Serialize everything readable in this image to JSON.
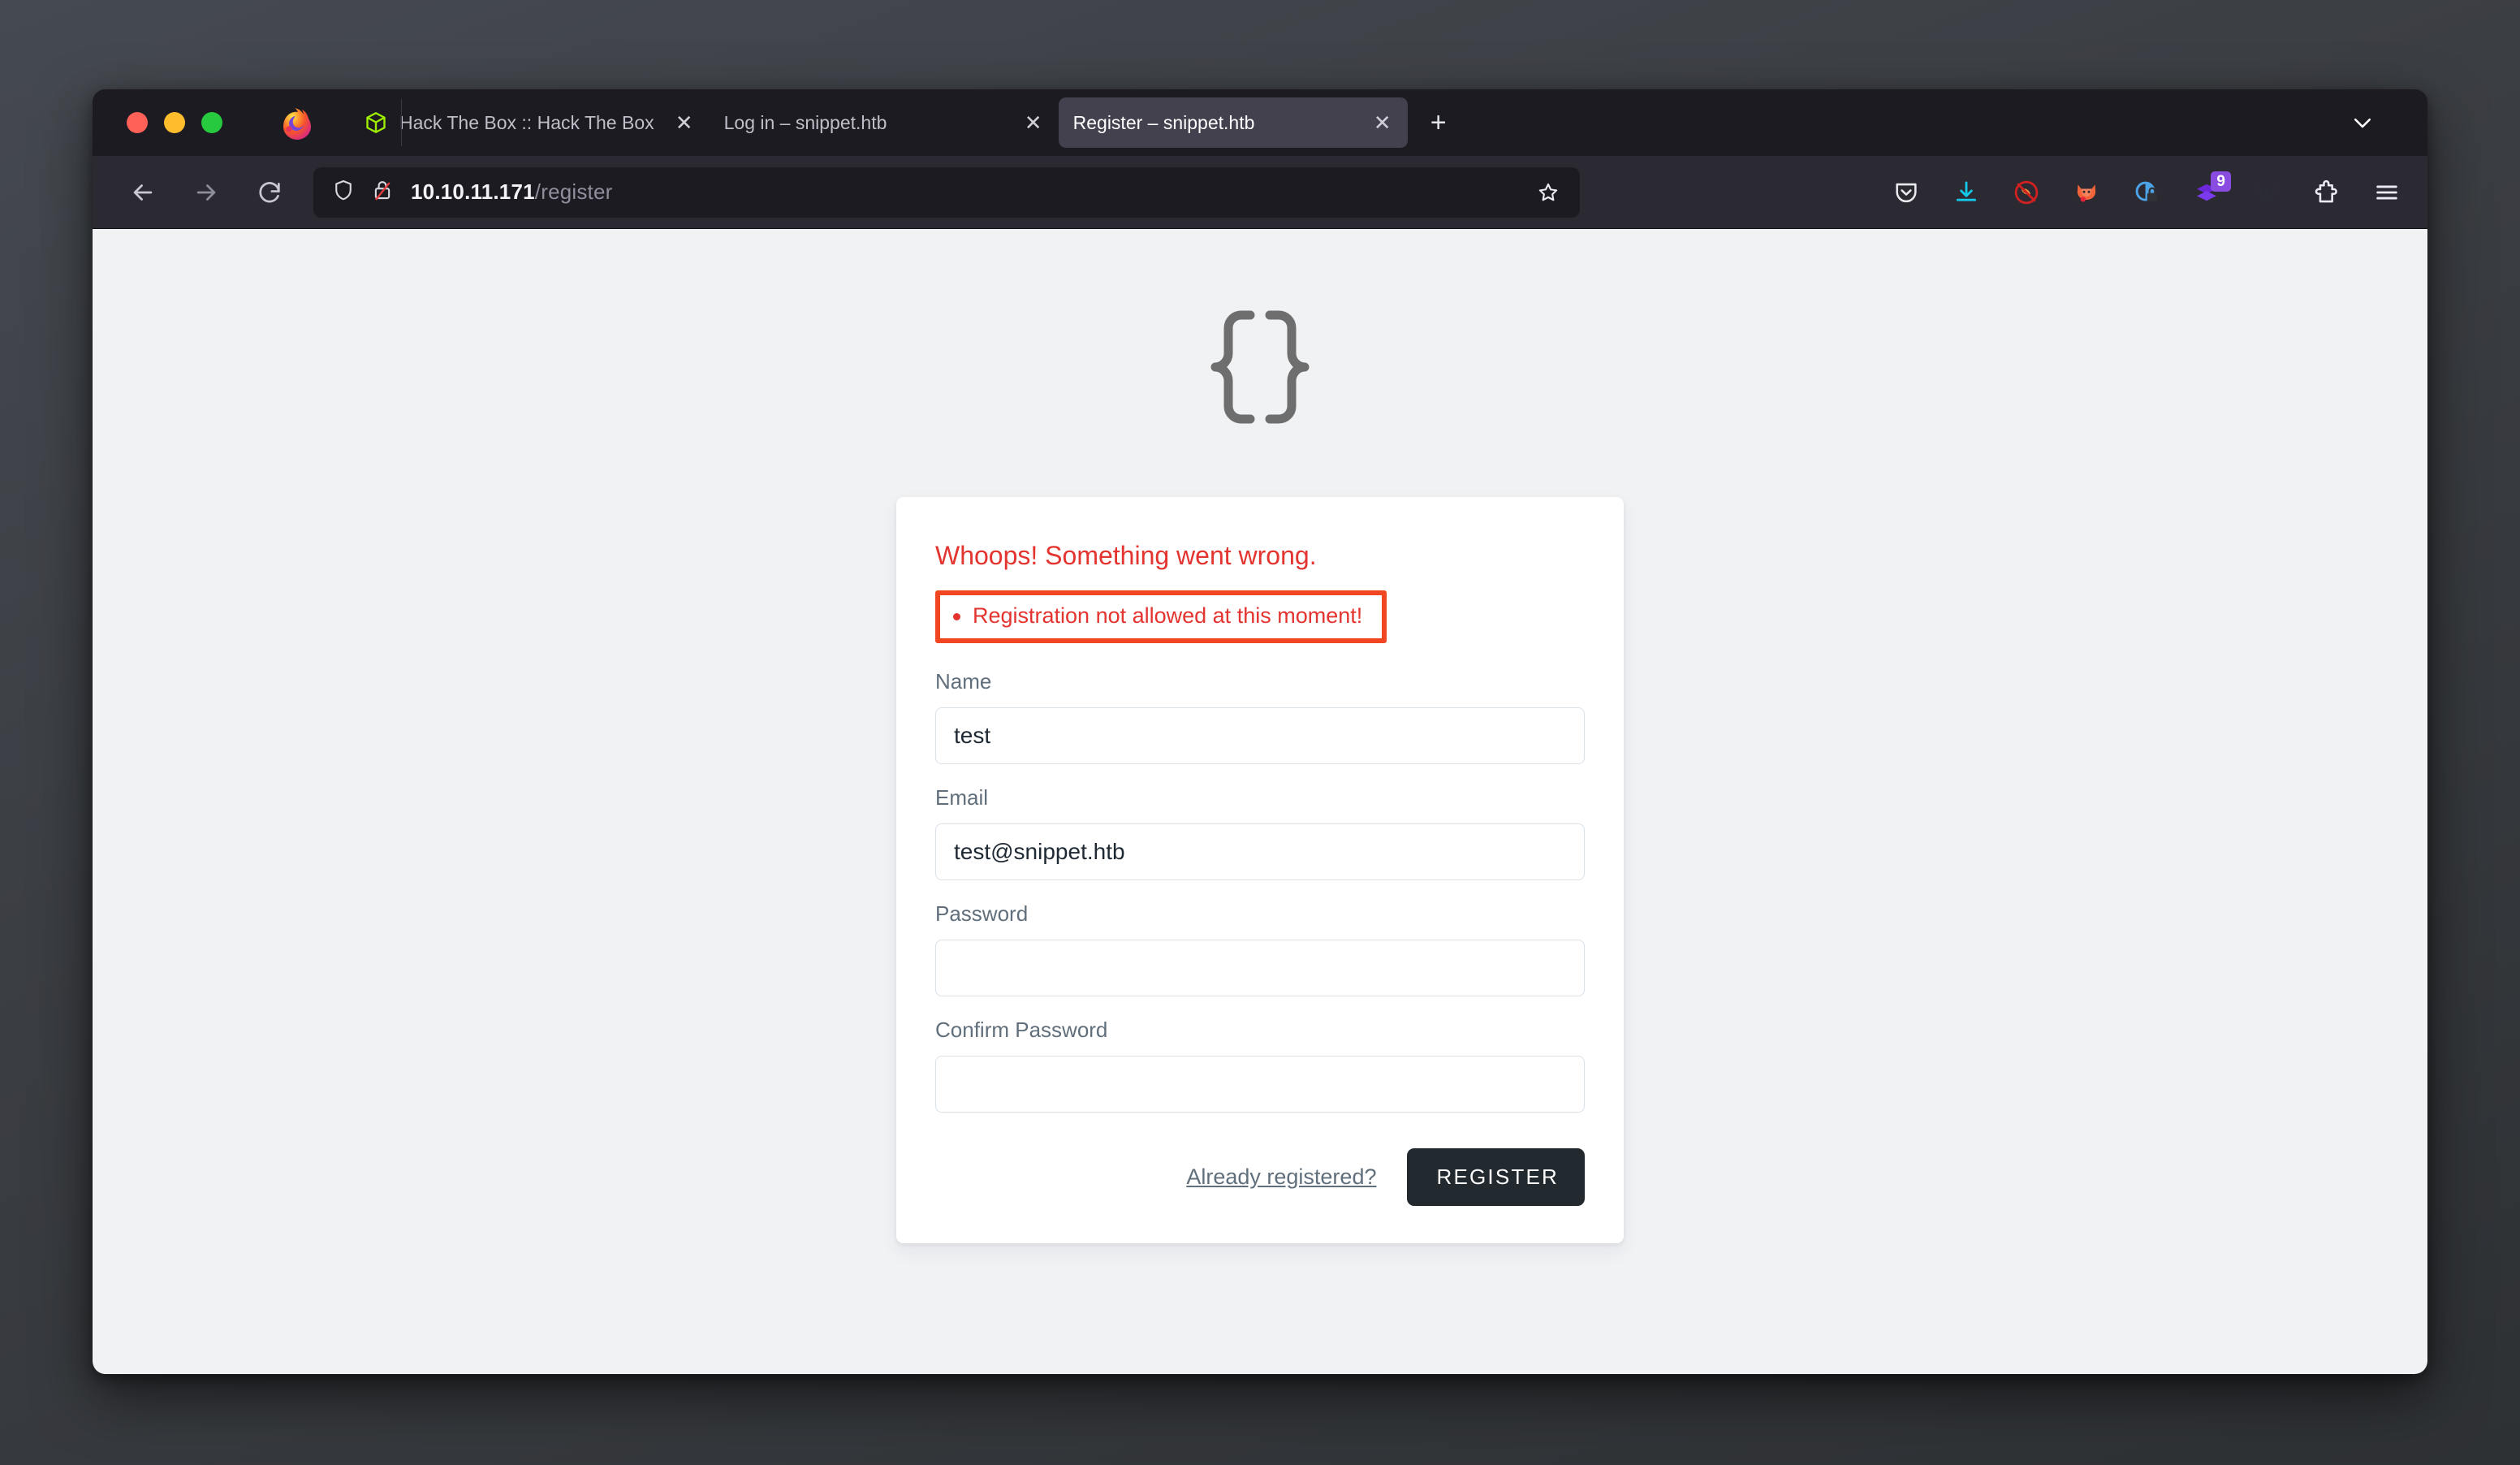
{
  "window": {
    "traffic_lights": [
      "close",
      "minimize",
      "zoom"
    ],
    "app_icon": "firefox-logo"
  },
  "tabs": [
    {
      "title": "Hack The Box :: Hack The Box",
      "favicon": "htb-cube-icon",
      "active": false,
      "close_label": "✕"
    },
    {
      "title": "Log in – snippet.htb",
      "favicon": "none",
      "active": false,
      "close_label": "✕"
    },
    {
      "title": "Register – snippet.htb",
      "favicon": "none",
      "active": true,
      "close_label": "✕"
    }
  ],
  "tabstrip": {
    "new_tab_label": "+",
    "list_all_tabs_icon": "chevron-down-icon"
  },
  "navbar": {
    "back_icon": "arrow-left-icon",
    "forward_icon": "arrow-right-icon",
    "reload_icon": "reload-icon",
    "shield_icon": "shield-icon",
    "lock_icon": "lock-crossed-icon",
    "url_host": "10.10.11.171",
    "url_path": "/register",
    "bookmark_icon": "star-icon",
    "extensions": [
      {
        "name": "pocket-icon",
        "badge": ""
      },
      {
        "name": "downloads-icon",
        "badge": ""
      },
      {
        "name": "foxyproxy-disabled-icon",
        "badge": ""
      },
      {
        "name": "fox-icon",
        "badge": ""
      },
      {
        "name": "privacy-lock-icon",
        "badge": ""
      },
      {
        "name": "purple-stack-icon",
        "badge": "9"
      },
      {
        "name": "wappalyzer-icon",
        "badge": ""
      },
      {
        "name": "extensions-puzzle-icon",
        "badge": ""
      },
      {
        "name": "app-menu-icon",
        "badge": ""
      }
    ]
  },
  "page": {
    "logo": "curly-braces-logo",
    "error": {
      "heading": "Whoops! Something went wrong.",
      "messages": [
        "Registration not allowed at this moment!"
      ],
      "heading_color": "#e3342f",
      "highlight_border_color": "#f04622"
    },
    "form": {
      "fields": [
        {
          "label": "Name",
          "value": "test",
          "placeholder": "",
          "type": "text"
        },
        {
          "label": "Email",
          "value": "test@snippet.htb",
          "placeholder": "",
          "type": "text"
        },
        {
          "label": "Password",
          "value": "",
          "placeholder": "",
          "type": "password"
        },
        {
          "label": "Confirm Password",
          "value": "",
          "placeholder": "",
          "type": "password"
        }
      ],
      "already_registered_label": "Already registered?",
      "submit_label": "REGISTER",
      "submit_color": "#22292f"
    }
  }
}
